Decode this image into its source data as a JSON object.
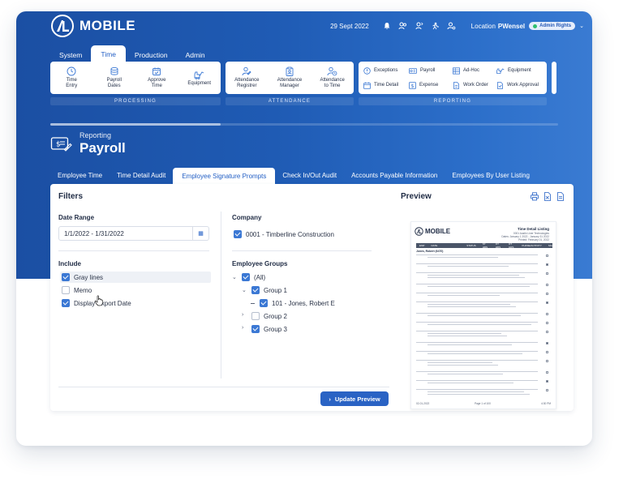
{
  "app": {
    "logo_text": "MOBILE"
  },
  "topbar": {
    "date": "29 Sept 2022",
    "location_label": "Location",
    "location_value": "PWensel",
    "rights_badge": "Admin Rights"
  },
  "nav": {
    "tabs": [
      {
        "label": "System"
      },
      {
        "label": "Time",
        "active": true
      },
      {
        "label": "Production"
      },
      {
        "label": "Admin"
      }
    ]
  },
  "ribbon": {
    "processing": {
      "label": "PROCESSING",
      "items": [
        {
          "label1": "Time",
          "label2": "Entry",
          "icon": "clock-icon"
        },
        {
          "label1": "Payroll",
          "label2": "Dates",
          "icon": "database-icon"
        },
        {
          "label1": "Approve",
          "label2": "Time",
          "icon": "calendar-check-icon"
        },
        {
          "label1": "Equipment",
          "label2": "",
          "icon": "equipment-icon"
        }
      ]
    },
    "attendance": {
      "label": "ATTENDANCE",
      "items": [
        {
          "label1": "Attendance",
          "label2": "Registrer",
          "icon": "user-edit-icon"
        },
        {
          "label1": "Attendance",
          "label2": "Manager",
          "icon": "clipboard-user-icon"
        },
        {
          "label1": "Attendance",
          "label2": "to Time",
          "icon": "user-clock-icon"
        }
      ]
    },
    "reporting": {
      "label": "REPORTING",
      "items": [
        {
          "label": "Exceptions",
          "icon": "alert-circle-icon"
        },
        {
          "label": "Payroll",
          "icon": "payroll-icon"
        },
        {
          "label": "Ad-Hoc",
          "icon": "table-icon"
        },
        {
          "label": "Equipment",
          "icon": "equipment-icon"
        },
        {
          "label": "Time Detail",
          "icon": "calendar-icon"
        },
        {
          "label": "Expense",
          "icon": "dollar-icon"
        },
        {
          "label": "Work Order",
          "icon": "document-icon"
        },
        {
          "label": "Work Approval",
          "icon": "document-check-icon"
        }
      ]
    }
  },
  "page": {
    "supertitle": "Reporting",
    "title": "Payroll"
  },
  "subtabs": [
    {
      "label": "Employee Time"
    },
    {
      "label": "Time Detail Audit"
    },
    {
      "label": "Employee Signature Prompts",
      "active": true
    },
    {
      "label": "Check In/Out Audit"
    },
    {
      "label": "Accounts Payable Information"
    },
    {
      "label": "Employees By User Listing"
    }
  ],
  "filters": {
    "heading": "Filters",
    "date_range_label": "Date Range",
    "date_range_value": "1/1/2022 - 1/31/2022",
    "include_label": "Include",
    "include_options": [
      {
        "label": "Gray lines",
        "checked": true
      },
      {
        "label": "Memo",
        "checked": false
      },
      {
        "label": "Display Export Date",
        "checked": true
      }
    ],
    "company_label": "Company",
    "company_value": "0001 - Timberline Construction",
    "groups_label": "Employee Groups",
    "groups": {
      "all": "(All)",
      "group1": "Group 1",
      "emp1": "101 - Jones, Robert E",
      "group2": "Group 2",
      "group3": "Group 3"
    },
    "update_button": "Update Preview"
  },
  "preview": {
    "heading": "Preview",
    "doc_logo": "MOBILE",
    "doc_title": "Time Detail Listing",
    "doc_company": "0001 Austin Liner Technologies",
    "doc_daterange": "Dates: January 1 2022 - January 31 2022",
    "doc_printed": "Printed: February 01, 2022",
    "doc_columns": [
      "EMP",
      "DATE",
      "STATUS",
      "ST HRS",
      "OT HRS",
      "DT HRS",
      "PHASE/ACTIVITY",
      "SIG"
    ],
    "doc_employee": "Jones, Robert (6470)",
    "doc_footer_left": "02-01-2022",
    "doc_footer_center": "Page 1 of 100",
    "doc_footer_right": "4:30 PM"
  }
}
